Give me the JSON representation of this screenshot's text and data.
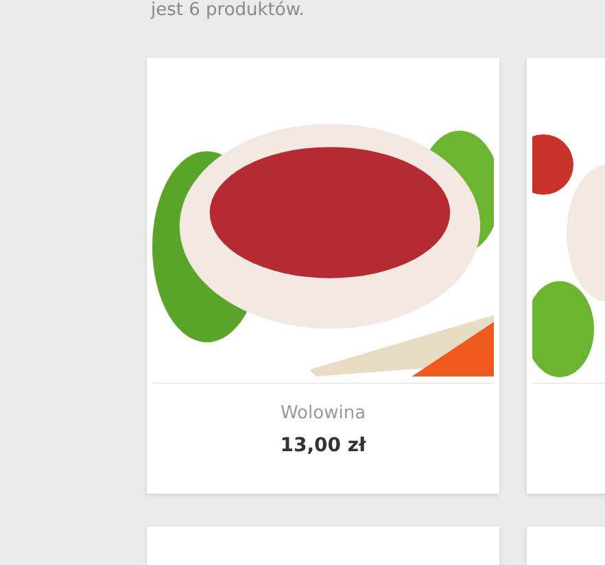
{
  "intro_text": "jest 6 produktów.",
  "products": [
    {
      "name": "Wolowina",
      "price": "13,00 zł"
    }
  ]
}
